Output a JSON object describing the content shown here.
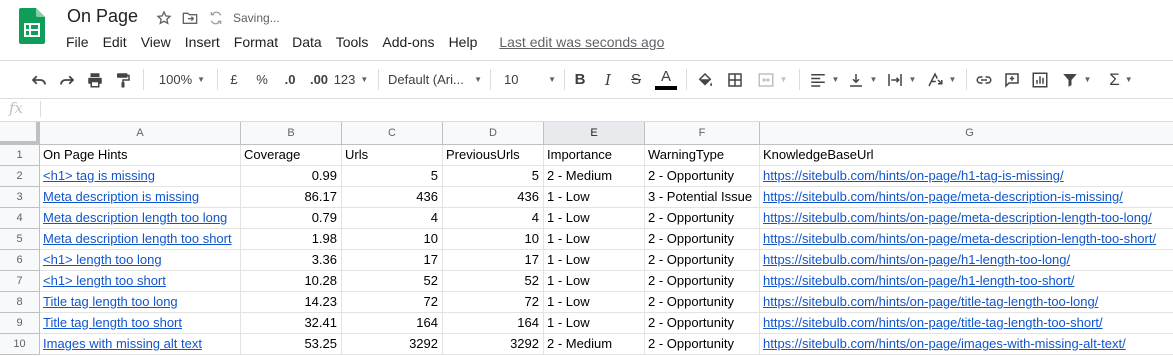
{
  "title": "On Page",
  "saving_status": "Saving...",
  "menu": [
    "File",
    "Edit",
    "View",
    "Insert",
    "Format",
    "Data",
    "Tools",
    "Add-ons",
    "Help"
  ],
  "last_edit": "Last edit was seconds ago",
  "toolbar": {
    "zoom": "100%",
    "currency": "£",
    "percent": "%",
    "dec_decrease": ".0",
    "dec_increase": ".00",
    "more_formats": "123",
    "font": "Default (Ari...",
    "font_size": "10",
    "bold": "B",
    "italic": "I",
    "strike": "S",
    "text_color_glyph": "A",
    "text_color": "#000000",
    "functions": "Σ"
  },
  "formula_bar": {
    "fx_label": "fx",
    "value": ""
  },
  "columns": [
    "A",
    "B",
    "C",
    "D",
    "E",
    "F",
    "G"
  ],
  "selected_column": "E",
  "rows": [
    {
      "num": "1",
      "a": "On Page Hints",
      "b": "Coverage",
      "c": "Urls",
      "d": "PreviousUrls",
      "e": "Importance",
      "f": "WarningType",
      "g": "KnowledgeBaseUrl"
    },
    {
      "num": "2",
      "a": "<h1> tag is missing",
      "b": "0.99",
      "c": "5",
      "d": "5",
      "e": "2 - Medium",
      "f": "2 - Opportunity",
      "g": "https://sitebulb.com/hints/on-page/h1-tag-is-missing/"
    },
    {
      "num": "3",
      "a": "Meta description is missing",
      "b": "86.17",
      "c": "436",
      "d": "436",
      "e": "1 - Low",
      "f": "3 - Potential Issue",
      "g": "https://sitebulb.com/hints/on-page/meta-description-is-missing/"
    },
    {
      "num": "4",
      "a": "Meta description length too long",
      "b": "0.79",
      "c": "4",
      "d": "4",
      "e": "1 - Low",
      "f": "2 - Opportunity",
      "g": "https://sitebulb.com/hints/on-page/meta-description-length-too-long/"
    },
    {
      "num": "5",
      "a": "Meta description length too short",
      "b": "1.98",
      "c": "10",
      "d": "10",
      "e": "1 - Low",
      "f": "2 - Opportunity",
      "g": "https://sitebulb.com/hints/on-page/meta-description-length-too-short/"
    },
    {
      "num": "6",
      "a": "<h1> length too long",
      "b": "3.36",
      "c": "17",
      "d": "17",
      "e": "1 - Low",
      "f": "2 - Opportunity",
      "g": "https://sitebulb.com/hints/on-page/h1-length-too-long/"
    },
    {
      "num": "7",
      "a": "<h1> length too short",
      "b": "10.28",
      "c": "52",
      "d": "52",
      "e": "1 - Low",
      "f": "2 - Opportunity",
      "g": "https://sitebulb.com/hints/on-page/h1-length-too-short/"
    },
    {
      "num": "8",
      "a": "Title tag length too long",
      "b": "14.23",
      "c": "72",
      "d": "72",
      "e": "1 - Low",
      "f": "2 - Opportunity",
      "g": "https://sitebulb.com/hints/on-page/title-tag-length-too-long/"
    },
    {
      "num": "9",
      "a": "Title tag length too short",
      "b": "32.41",
      "c": "164",
      "d": "164",
      "e": "1 - Low",
      "f": "2 - Opportunity",
      "g": "https://sitebulb.com/hints/on-page/title-tag-length-too-short/"
    },
    {
      "num": "10",
      "a": "Images with missing alt text",
      "b": "53.25",
      "c": "3292",
      "d": "3292",
      "e": "2 - Medium",
      "f": "2 - Opportunity",
      "g": "https://sitebulb.com/hints/on-page/images-with-missing-alt-text/"
    }
  ],
  "colors": {
    "sheets_green": "#0f9d58",
    "link": "#1155cc",
    "header_bg": "#f8f9fa",
    "selected_header_bg": "#e8eaed"
  }
}
